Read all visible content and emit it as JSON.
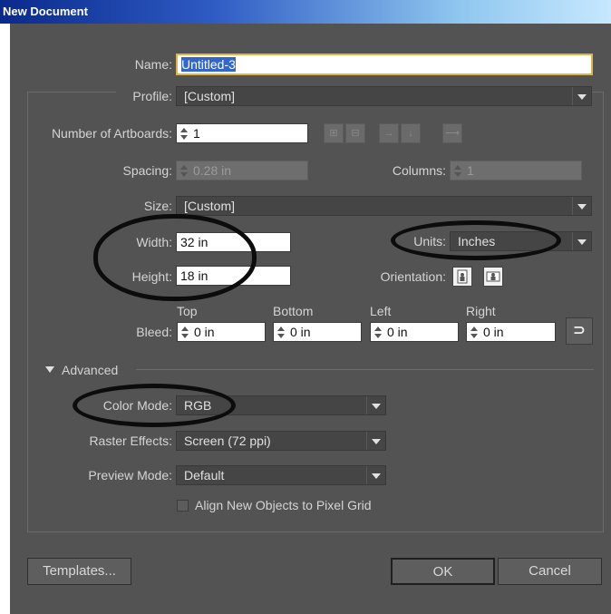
{
  "window": {
    "title": "New Document"
  },
  "name": {
    "label": "Name:",
    "value": "Untitled-3"
  },
  "profile": {
    "label": "Profile:",
    "value": "[Custom]"
  },
  "artboards": {
    "label": "Number of Artboards:",
    "value": "1"
  },
  "spacing": {
    "label": "Spacing:",
    "value": "0.28 in"
  },
  "columns": {
    "label": "Columns:",
    "value": "1"
  },
  "size": {
    "label": "Size:",
    "value": "[Custom]"
  },
  "width": {
    "label": "Width:",
    "value": "32 in"
  },
  "height": {
    "label": "Height:",
    "value": "18 in"
  },
  "units": {
    "label": "Units:",
    "value": "Inches"
  },
  "orientation": {
    "label": "Orientation:"
  },
  "bleed": {
    "label": "Bleed:",
    "top": {
      "label": "Top",
      "value": "0 in"
    },
    "bottom": {
      "label": "Bottom",
      "value": "0 in"
    },
    "left": {
      "label": "Left",
      "value": "0 in"
    },
    "right": {
      "label": "Right",
      "value": "0 in"
    }
  },
  "advanced": {
    "label": "Advanced"
  },
  "color_mode": {
    "label": "Color Mode:",
    "value": "RGB"
  },
  "raster_effects": {
    "label": "Raster Effects:",
    "value": "Screen (72 ppi)"
  },
  "preview_mode": {
    "label": "Preview Mode:",
    "value": "Default"
  },
  "pixel_grid": {
    "label": "Align New Objects to Pixel Grid",
    "checked": false
  },
  "buttons": {
    "templates": "Templates...",
    "ok": "OK",
    "cancel": "Cancel"
  },
  "colors": {
    "dialog_bg": "#535353",
    "field_bg": "#ffffff",
    "accent_border": "#e0b446",
    "annotation": "#0c0c0c"
  }
}
